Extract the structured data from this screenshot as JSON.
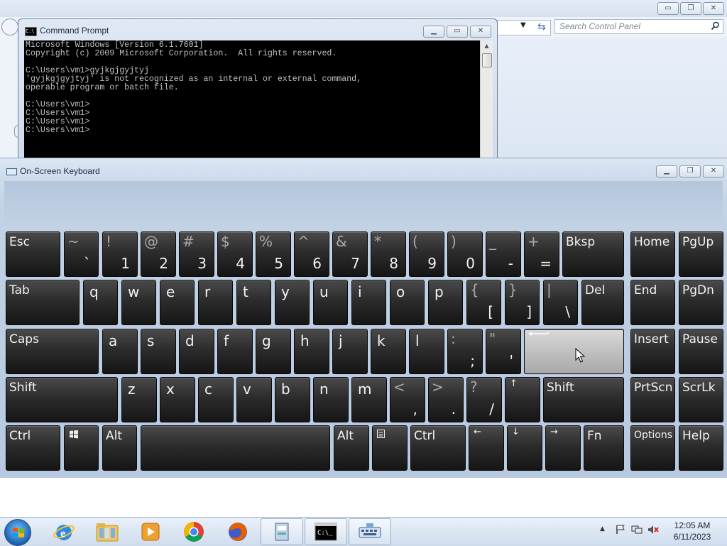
{
  "control_panel": {
    "search_placeholder": "Search Control Panel",
    "caption_minimize": "▭",
    "caption_restore": "❐",
    "caption_close": "✕"
  },
  "command_prompt": {
    "title": "Command Prompt",
    "lines": [
      "Microsoft Windows [Version 6.1.7601]",
      "Copyright (c) 2009 Microsoft Corporation.  All rights reserved.",
      "",
      "C:\\Users\\vm1>gyjkgjgyjtyj",
      "'gyjkgjgyjtyj' is not recognized as an internal or external command,",
      "operable program or batch file.",
      "",
      "C:\\Users\\vm1>",
      "C:\\Users\\vm1>",
      "C:\\Users\\vm1>",
      "C:\\Users\\vm1>"
    ]
  },
  "osk": {
    "title": "On-Screen Keyboard",
    "rows": [
      [
        {
          "label": "Esc",
          "name": "key-esc"
        },
        {
          "shift": "~",
          "main": "`",
          "name": "key-backtick"
        },
        {
          "shift": "!",
          "main": "1",
          "name": "key-1"
        },
        {
          "shift": "@",
          "main": "2",
          "name": "key-2"
        },
        {
          "shift": "#",
          "main": "3",
          "name": "key-3"
        },
        {
          "shift": "$",
          "main": "4",
          "name": "key-4"
        },
        {
          "shift": "%",
          "main": "5",
          "name": "key-5"
        },
        {
          "shift": "^",
          "main": "6",
          "name": "key-6"
        },
        {
          "shift": "&",
          "main": "7",
          "name": "key-7"
        },
        {
          "shift": "*",
          "main": "8",
          "name": "key-8"
        },
        {
          "shift": "(",
          "main": "9",
          "name": "key-9"
        },
        {
          "shift": ")",
          "main": "0",
          "name": "key-0"
        },
        {
          "shift": "_",
          "main": "-",
          "name": "key-minus"
        },
        {
          "shift": "+",
          "main": "=",
          "name": "key-equals"
        },
        {
          "label": "Bksp",
          "name": "key-backspace"
        },
        {
          "label": "Home",
          "name": "key-home"
        },
        {
          "label": "PgUp",
          "name": "key-pgup"
        }
      ],
      [
        {
          "label": "Tab",
          "name": "key-tab"
        },
        {
          "letter": "q",
          "name": "key-q"
        },
        {
          "letter": "w",
          "name": "key-w"
        },
        {
          "letter": "e",
          "name": "key-e"
        },
        {
          "letter": "r",
          "name": "key-r"
        },
        {
          "letter": "t",
          "name": "key-t"
        },
        {
          "letter": "y",
          "name": "key-y"
        },
        {
          "letter": "u",
          "name": "key-u"
        },
        {
          "letter": "i",
          "name": "key-i"
        },
        {
          "letter": "o",
          "name": "key-o"
        },
        {
          "letter": "p",
          "name": "key-p"
        },
        {
          "shift": "{",
          "main": "[",
          "name": "key-open-bracket"
        },
        {
          "shift": "}",
          "main": "]",
          "name": "key-close-bracket"
        },
        {
          "shift": "|",
          "main": "\\",
          "name": "key-backslash"
        },
        {
          "label": "Del",
          "name": "key-del"
        },
        {
          "label": "End",
          "name": "key-end"
        },
        {
          "label": "PgDn",
          "name": "key-pgdn"
        }
      ],
      [
        {
          "label": "Caps",
          "name": "key-caps"
        },
        {
          "letter": "a",
          "name": "key-a"
        },
        {
          "letter": "s",
          "name": "key-s"
        },
        {
          "letter": "d",
          "name": "key-d"
        },
        {
          "letter": "f",
          "name": "key-f"
        },
        {
          "letter": "g",
          "name": "key-g"
        },
        {
          "letter": "h",
          "name": "key-h"
        },
        {
          "letter": "j",
          "name": "key-j"
        },
        {
          "letter": "k",
          "name": "key-k"
        },
        {
          "letter": "l",
          "name": "key-l"
        },
        {
          "shift": ":",
          "main": ";",
          "name": "key-semicolon"
        },
        {
          "shift": "\"",
          "main": "'",
          "name": "key-quote"
        },
        {
          "enter": true,
          "name": "key-enter"
        },
        {
          "label": "Insert",
          "name": "key-insert"
        },
        {
          "label": "Pause",
          "name": "key-pause"
        }
      ],
      [
        {
          "label": "Shift",
          "name": "key-left-shift"
        },
        {
          "letter": "z",
          "name": "key-z"
        },
        {
          "letter": "x",
          "name": "key-x"
        },
        {
          "letter": "c",
          "name": "key-c"
        },
        {
          "letter": "v",
          "name": "key-v"
        },
        {
          "letter": "b",
          "name": "key-b"
        },
        {
          "letter": "n",
          "name": "key-n"
        },
        {
          "letter": "m",
          "name": "key-m"
        },
        {
          "shift": "<",
          "main": ",",
          "name": "key-comma"
        },
        {
          "shift": ">",
          "main": ".",
          "name": "key-period"
        },
        {
          "shift": "?",
          "main": "/",
          "name": "key-slash"
        },
        {
          "arrow": "↑",
          "name": "key-up-arrow"
        },
        {
          "label": "Shift",
          "name": "key-right-shift"
        },
        {
          "label": "PrtScn",
          "name": "key-prtscn"
        },
        {
          "label": "ScrLk",
          "name": "key-scrlk"
        }
      ],
      [
        {
          "label": "Ctrl",
          "name": "key-left-ctrl"
        },
        {
          "windows": true,
          "name": "key-windows"
        },
        {
          "label": "Alt",
          "name": "key-left-alt"
        },
        {
          "space": true,
          "name": "key-space"
        },
        {
          "label": "Alt",
          "name": "key-right-alt"
        },
        {
          "menu": true,
          "name": "key-menu"
        },
        {
          "label": "Ctrl",
          "name": "key-right-ctrl"
        },
        {
          "arrow": "←",
          "name": "key-left-arrow"
        },
        {
          "arrow": "↓",
          "name": "key-down-arrow"
        },
        {
          "arrow": "→",
          "name": "key-right-arrow"
        },
        {
          "label": "Fn",
          "name": "key-fn"
        },
        {
          "small": "Options",
          "name": "key-options"
        },
        {
          "label": "Help",
          "name": "key-help"
        }
      ]
    ]
  },
  "taskbar": {
    "items": [
      {
        "name": "taskbar-internet-explorer",
        "icon": "internet-explorer-icon",
        "active": false
      },
      {
        "name": "taskbar-windows-explorer",
        "icon": "folder-icon",
        "active": false
      },
      {
        "name": "taskbar-media-player",
        "icon": "media-player-icon",
        "active": false
      },
      {
        "name": "taskbar-chrome",
        "icon": "chrome-icon",
        "active": false
      },
      {
        "name": "taskbar-firefox",
        "icon": "firefox-icon",
        "active": false
      },
      {
        "name": "taskbar-control-panel",
        "icon": "control-panel-icon",
        "active": true
      },
      {
        "name": "taskbar-command-prompt",
        "icon": "command-prompt-icon",
        "active": true
      },
      {
        "name": "taskbar-on-screen-keyboard",
        "icon": "keyboard-icon",
        "active": true
      }
    ],
    "clock_time": "12:05 AM",
    "clock_date": "6/11/2023",
    "tray_chevron": "▲"
  }
}
